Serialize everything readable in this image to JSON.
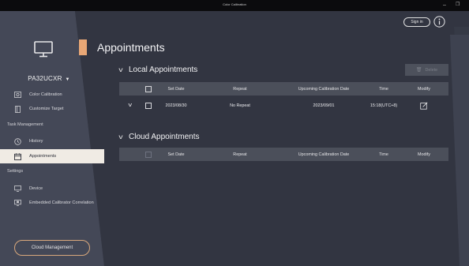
{
  "window": {
    "title": "Color Calibration",
    "minimize": "–",
    "restore": "❐"
  },
  "header": {
    "signin_label": "Sign in"
  },
  "sidebar": {
    "model": "PA32UCXR",
    "items": [
      {
        "label": "Color Calibration"
      },
      {
        "label": "Customize Target"
      }
    ],
    "task_section": "Task Management",
    "task_items": [
      {
        "label": "History"
      },
      {
        "label": "Appointments"
      }
    ],
    "settings_section": "Settings",
    "settings_items": [
      {
        "label": "Device"
      },
      {
        "label": "Embedded Calibrator Correlation"
      }
    ],
    "cloud_button": "Cloud Management"
  },
  "main": {
    "title": "Appointments",
    "local": {
      "heading": "Local Appointments",
      "delete_label": "Delete",
      "columns": {
        "set_date": "Set Date",
        "repeat": "Repeat",
        "upcoming": "Upcoming Calibration Date",
        "time": "Time",
        "modify": "Modify"
      },
      "rows": [
        {
          "set_date": "2023/08/30",
          "repeat": "No Repeat",
          "upcoming": "2023/09/01",
          "time": "15:18(UTC+8)"
        }
      ]
    },
    "cloud": {
      "heading": "Cloud Appointments",
      "columns": {
        "set_date": "Set Date",
        "repeat": "Repeat",
        "upcoming": "Upcoming Calibration Date",
        "time": "Time",
        "modify": "Modify"
      }
    }
  },
  "colors": {
    "accent": "#e8a776",
    "active_bg": "#f0ebe4",
    "background": "#363a46",
    "table_header": "#4b4f5a"
  },
  "icons": [
    "monitor-icon",
    "info-icon",
    "color-calibration-icon",
    "customize-target-icon",
    "history-icon",
    "calendar-icon",
    "device-icon",
    "embedded-calibrator-icon",
    "trash-icon",
    "edit-icon",
    "chevron-down-icon"
  ]
}
